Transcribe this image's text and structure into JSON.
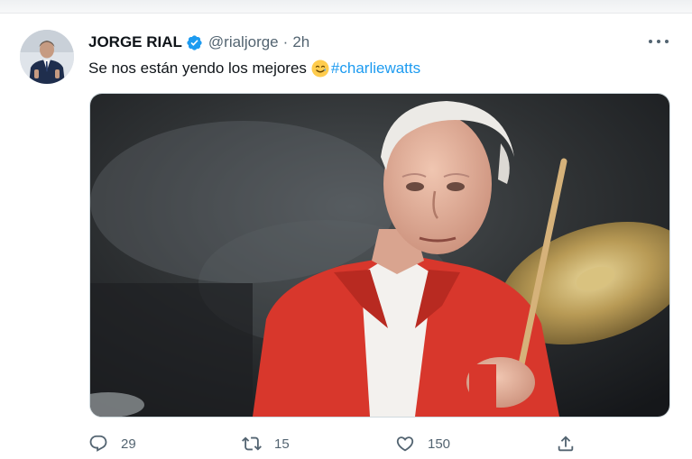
{
  "tweet": {
    "author_name": "JORGE RIAL",
    "handle": "@rialjorge",
    "separator": "·",
    "time": "2h",
    "text": "Se nos están yendo los mejores",
    "emoji": "smiling-tear-emoji",
    "hashtag": "#charliewatts"
  },
  "actions": {
    "replies": "29",
    "retweets": "15",
    "likes": "150"
  },
  "icons": {
    "verified": "verified-badge-icon",
    "more": "more-options-icon",
    "reply": "reply-icon",
    "retweet": "retweet-icon",
    "like": "like-icon",
    "share": "share-icon"
  },
  "colors": {
    "accent": "#1d9bf0",
    "secondary_text": "#536471",
    "primary_text": "#0f1419"
  }
}
